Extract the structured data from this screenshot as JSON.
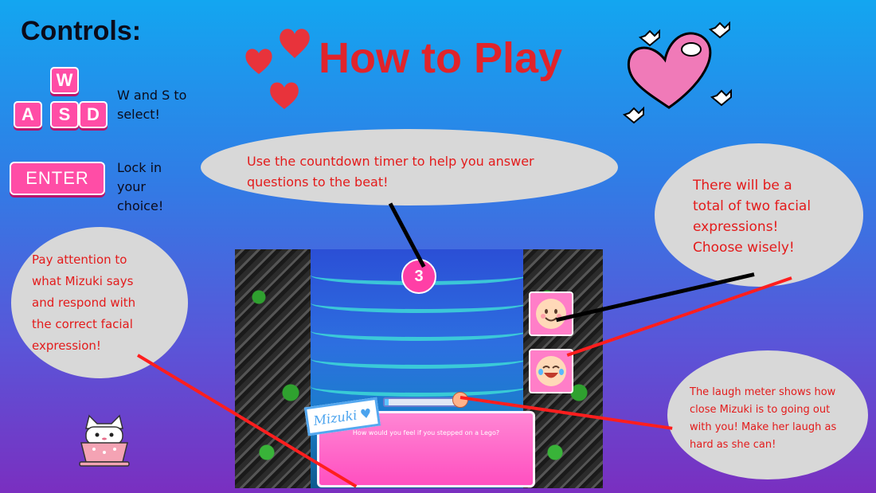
{
  "controls": {
    "title": "Controls:",
    "keys": [
      "W",
      "A",
      "S",
      "D"
    ],
    "wasd_text": [
      "W and S to",
      "select!"
    ],
    "enter_label": "ENTER",
    "enter_text": [
      "Lock in",
      "your",
      "choice!"
    ]
  },
  "title": "How to Play",
  "bubbles": {
    "timer": [
      "Use the countdown timer to help you answer",
      "questions to the beat!"
    ],
    "expressions": [
      "There will be a",
      "total of two facial",
      "expressions!",
      "Choose wisely!"
    ],
    "attention": [
      "Pay attention to",
      "what Mizuki says",
      "and respond with",
      "the correct facial",
      "expression!"
    ],
    "meter": [
      "The laugh meter shows how",
      "close Mizuki is to going out",
      "with you! Make her laugh as",
      "hard as she can!"
    ]
  },
  "game": {
    "timer_value": "3",
    "character_name": "Mizuki",
    "dialog": "How would you feel if you stepped on a Lego?",
    "laugh_meter_level": 0.05
  },
  "colors": {
    "accent_pink": "#ff4da6",
    "title_red": "#e0242b",
    "bubble_text_red": "#e31b1b"
  },
  "icons": [
    "heart-icon",
    "smile-face-icon",
    "laughing-face-icon",
    "cat-cup-icon"
  ]
}
